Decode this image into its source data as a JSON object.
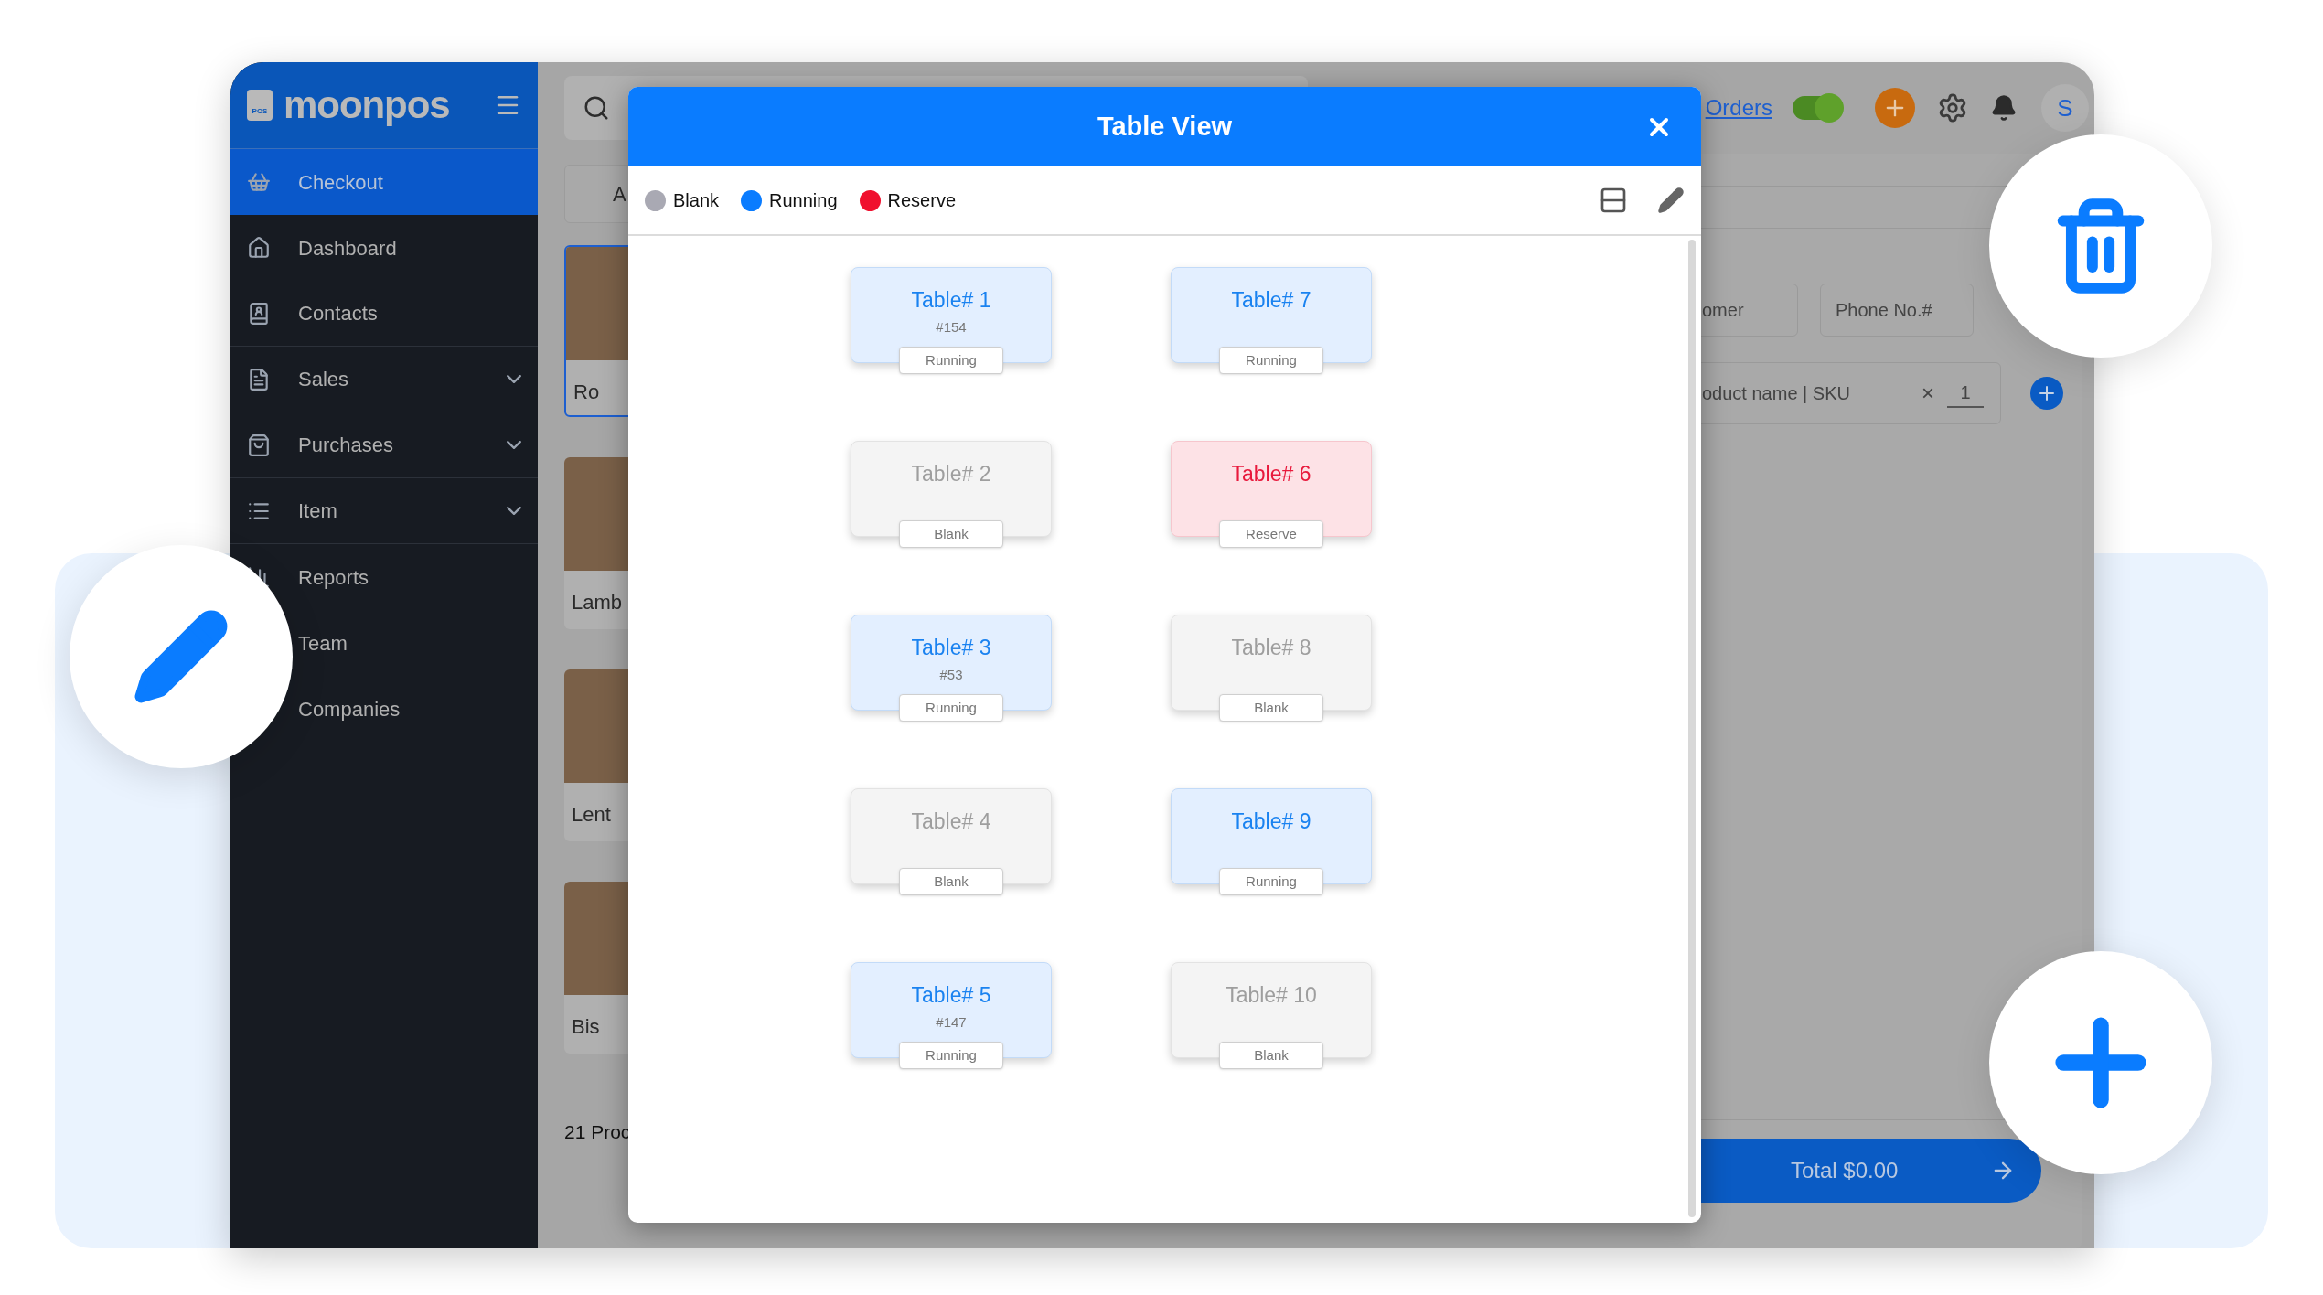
{
  "sidebar": {
    "logo": "moonpos",
    "logo_badge": "POS",
    "items": [
      {
        "label": "Checkout",
        "selected": true,
        "expandable": false
      },
      {
        "label": "Dashboard",
        "selected": false,
        "expandable": false
      },
      {
        "label": "Contacts",
        "selected": false,
        "expandable": false
      },
      {
        "label": "Sales",
        "selected": false,
        "expandable": true
      },
      {
        "label": "Purchases",
        "selected": false,
        "expandable": true
      },
      {
        "label": "Item",
        "selected": false,
        "expandable": true
      },
      {
        "label": "Reports",
        "selected": false,
        "expandable": false
      },
      {
        "label": "Team",
        "selected": false,
        "expandable": false
      },
      {
        "label": "Companies",
        "selected": false,
        "expandable": false
      }
    ]
  },
  "topbar": {
    "orders_link": "Orders",
    "orders_toggle": {
      "on": true
    },
    "avatar": "S"
  },
  "products": {
    "tab": "A",
    "items": [
      {
        "name": "Ro",
        "selected": true
      },
      {
        "name": "Lamb",
        "selected": false
      },
      {
        "name": "Lent",
        "selected": false
      },
      {
        "name": "Bis",
        "selected": false
      }
    ],
    "count": "21 Proc"
  },
  "cart": {
    "customer_placeholder": "omer",
    "phone_placeholder": "Phone No.#",
    "product_placeholder": "oduct name | SKU",
    "clear": "×",
    "quantity": "1",
    "total_button": "Total $0.00"
  },
  "modal": {
    "title": "Table View",
    "legend": [
      {
        "label": "Blank",
        "color": "#a9a9b3"
      },
      {
        "label": "Running",
        "color": "#0a7cff"
      },
      {
        "label": "Reserve",
        "color": "#f0102e"
      }
    ],
    "columns": [
      [
        {
          "name": "Table# 1",
          "order": "#154",
          "status": "Running",
          "kind": "running"
        },
        {
          "name": "Table# 2",
          "status": "Blank",
          "kind": "blank"
        },
        {
          "name": "Table# 3",
          "order": "#53",
          "status": "Running",
          "kind": "running"
        },
        {
          "name": "Table# 4",
          "status": "Blank",
          "kind": "blank"
        },
        {
          "name": "Table# 5",
          "order": "#147",
          "status": "Running",
          "kind": "running"
        }
      ],
      [
        {
          "name": "Table# 7",
          "status": "Running",
          "kind": "running"
        },
        {
          "name": "Table# 6",
          "status": "Reserve",
          "kind": "reserve"
        },
        {
          "name": "Table# 8",
          "status": "Blank",
          "kind": "blank"
        },
        {
          "name": "Table# 9",
          "status": "Running",
          "kind": "running"
        },
        {
          "name": "Table# 10",
          "status": "Blank",
          "kind": "blank"
        }
      ]
    ]
  }
}
